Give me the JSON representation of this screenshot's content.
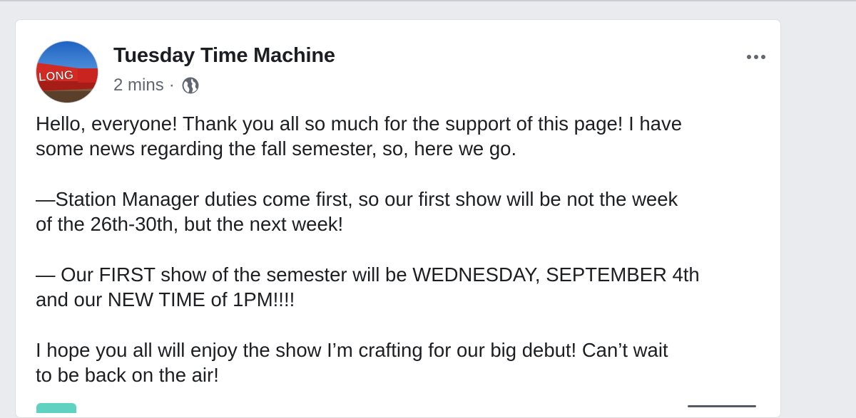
{
  "post": {
    "page_name": "Tuesday Time Machine",
    "timestamp": "2 mins",
    "separator": "·",
    "privacy_icon": "globe-icon",
    "more_icon": "more-horizontal-icon",
    "avatar_text": "LONG",
    "paragraphs": [
      {
        "lines": [
          "Hello, everyone! Thank you all so much for the support of this page! I have",
          "some news regarding the fall semester, so, here we go."
        ]
      },
      {
        "lines": [
          "—Station Manager duties come first, so our first show will be not the week",
          "of the 26th-30th, but the next week!"
        ]
      },
      {
        "lines": [
          "— Our FIRST show of the semester will be WEDNESDAY, SEPTEMBER 4th",
          "and our NEW TIME of 1PM!!!!"
        ]
      },
      {
        "lines": [
          "I hope you all will enjoy the show I’m crafting for our big debut! Can’t wait",
          "to be back on the air!"
        ]
      }
    ]
  },
  "colors": {
    "background": "#e9ebee",
    "card": "#ffffff",
    "text": "#1c1e21",
    "meta_text": "#606770"
  }
}
